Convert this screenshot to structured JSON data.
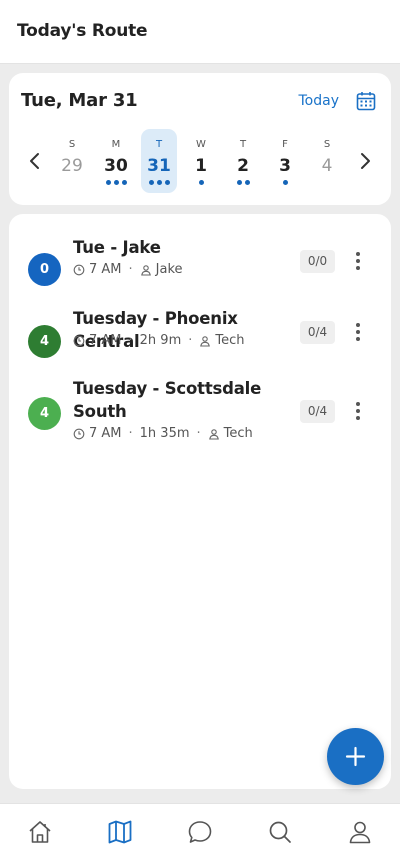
{
  "app_bar": {
    "title": "Today's Route"
  },
  "date_header": {
    "date_label": "Tue, Mar 31",
    "today_label": "Today",
    "calendar_icon": "calendar-icon"
  },
  "week": [
    {
      "dow": "S",
      "num": "29",
      "dots": 0,
      "selected": false,
      "muted": true
    },
    {
      "dow": "M",
      "num": "30",
      "dots": 3,
      "selected": false,
      "muted": false
    },
    {
      "dow": "T",
      "num": "31",
      "dots": 3,
      "selected": true,
      "muted": false
    },
    {
      "dow": "W",
      "num": "1",
      "dots": 1,
      "selected": false,
      "muted": false
    },
    {
      "dow": "T",
      "num": "2",
      "dots": 2,
      "selected": false,
      "muted": false
    },
    {
      "dow": "F",
      "num": "3",
      "dots": 1,
      "selected": false,
      "muted": false
    },
    {
      "dow": "S",
      "num": "4",
      "dots": 0,
      "selected": false,
      "muted": true
    }
  ],
  "routes": [
    {
      "badge": "0",
      "badge_color": "#1565c0",
      "name": "Tue - Jake",
      "time": "7 AM",
      "duration": "",
      "assignee": "Jake",
      "count": "0/0"
    },
    {
      "badge": "4",
      "badge_color": "#2e7d32",
      "name": "Tuesday - Phoenix Central",
      "time": "7 AM",
      "duration": "2h 9m",
      "assignee": "Tech",
      "count": "0/4"
    },
    {
      "badge": "4",
      "badge_color": "#4caf50",
      "name": "Tuesday - Scottsdale South",
      "time": "7 AM",
      "duration": "1h 35m",
      "assignee": "Tech",
      "count": "0/4"
    }
  ],
  "fab": {
    "icon": "plus-icon"
  },
  "bottom_nav": [
    {
      "icon": "home-icon",
      "active": false
    },
    {
      "icon": "map-icon",
      "active": true
    },
    {
      "icon": "chat-icon",
      "active": false
    },
    {
      "icon": "search-icon",
      "active": false
    },
    {
      "icon": "profile-icon",
      "active": false
    }
  ],
  "colors": {
    "accent": "#1a6fc4",
    "selected_bg": "#dcebf8",
    "text": "#222222",
    "muted": "#9a9a9a"
  }
}
